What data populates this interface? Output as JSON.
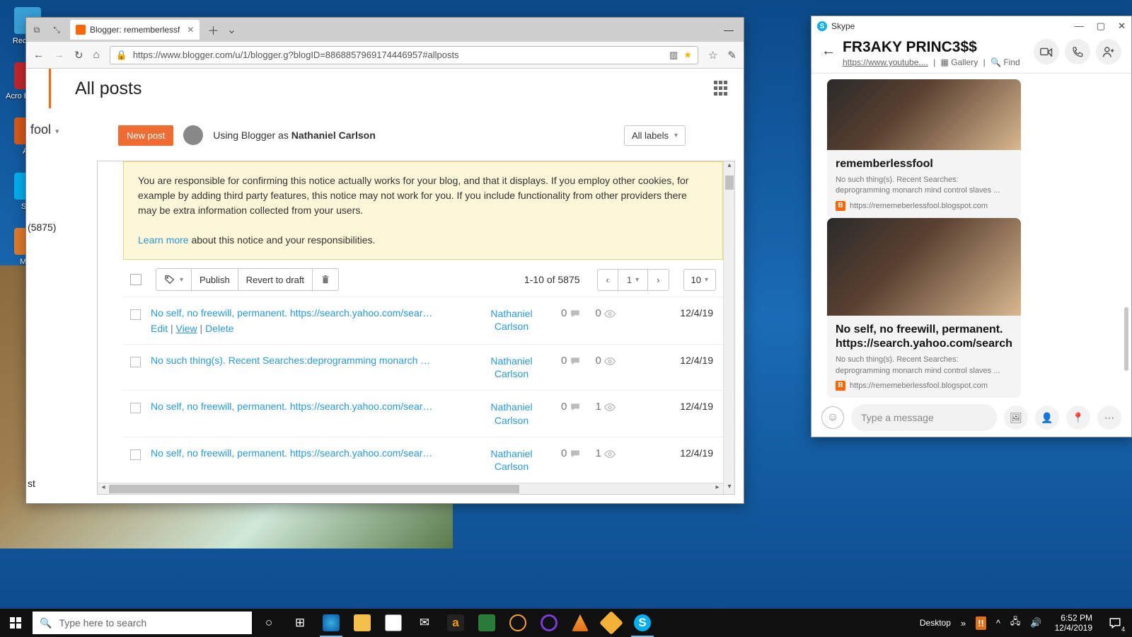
{
  "desktop": {
    "icons": [
      {
        "label": "Recycl...",
        "color": "#3aa0d8"
      },
      {
        "label": "Acro Reader",
        "color": "#c1272d"
      },
      {
        "label": "AV",
        "color": "#d65a1a"
      },
      {
        "label": "Sky",
        "color": "#00aff0",
        "badge": "(5875)"
      },
      {
        "label": "Med",
        "color": "#e07b2e"
      }
    ],
    "left_crumb": "st"
  },
  "browser": {
    "tab_title": "Blogger: rememberlessf",
    "url": "https://www.blogger.com/u/1/blogger.g?blogID=8868857969174446957#allposts",
    "page_title": "All posts",
    "blogname": "fool",
    "new_post": "New post",
    "using_as_prefix": "Using Blogger as ",
    "using_as_name": "Nathaniel Carlson",
    "all_labels": "All labels",
    "notice_text": "You are responsible for confirming this notice actually works for your blog, and that it displays. If you employ other cookies, for example by adding third party features, this notice may not work for you. If you include functionality from other providers there may be extra information collected from your users.",
    "learn_more": "Learn more",
    "learn_more_suffix": " about this notice and your responsibilities.",
    "toolbar": {
      "publish": "Publish",
      "revert": "Revert to draft"
    },
    "pagination": {
      "info": "1-10 of 5875",
      "page": "1",
      "perpage": "10"
    },
    "actions": {
      "edit": "Edit",
      "view": "View",
      "delete": "Delete"
    },
    "posts": [
      {
        "title": "No self, no freewill, permanent. https://search.yahoo.com/sear…",
        "author": "Nathaniel Carlson",
        "comments": "0",
        "views": "0",
        "date": "12/4/19",
        "show_actions": true
      },
      {
        "title": "No such thing(s). Recent Searches:deprogramming monarch …",
        "author": "Nathaniel Carlson",
        "comments": "0",
        "views": "0",
        "date": "12/4/19"
      },
      {
        "title": "No self, no freewill, permanent. https://search.yahoo.com/sear…",
        "author": "Nathaniel Carlson",
        "comments": "0",
        "views": "1",
        "date": "12/4/19"
      },
      {
        "title": "No self, no freewill, permanent. https://search.yahoo.com/sear…",
        "author": "Nathaniel Carlson",
        "comments": "0",
        "views": "1",
        "date": "12/4/19"
      }
    ]
  },
  "skype": {
    "app": "Skype",
    "contact": "FR3AKY PRINC3$$",
    "sub_link": "https://www.youtube....",
    "sub_gallery": "Gallery",
    "sub_find": "Find",
    "cards": [
      {
        "title": "rememberlessfool",
        "desc": "No such thing(s).               Recent Searches: deprogramming monarch mind control slaves ...",
        "src": "https://rememeberlessfool.blogspot.com",
        "tall": false
      },
      {
        "title": "No self, no freewill, permanent. https://search.yahoo.com/search",
        "desc": "No such thing(s).               Recent Searches: deprogramming monarch mind control slaves ...",
        "src": "https://rememeberlessfool.blogspot.com",
        "tall": true
      }
    ],
    "compose_placeholder": "Type a message"
  },
  "taskbar": {
    "search_placeholder": "Type here to search",
    "desktop_label": "Desktop",
    "time": "6:52 PM",
    "date": "12/4/2019",
    "notif_count": "4"
  }
}
